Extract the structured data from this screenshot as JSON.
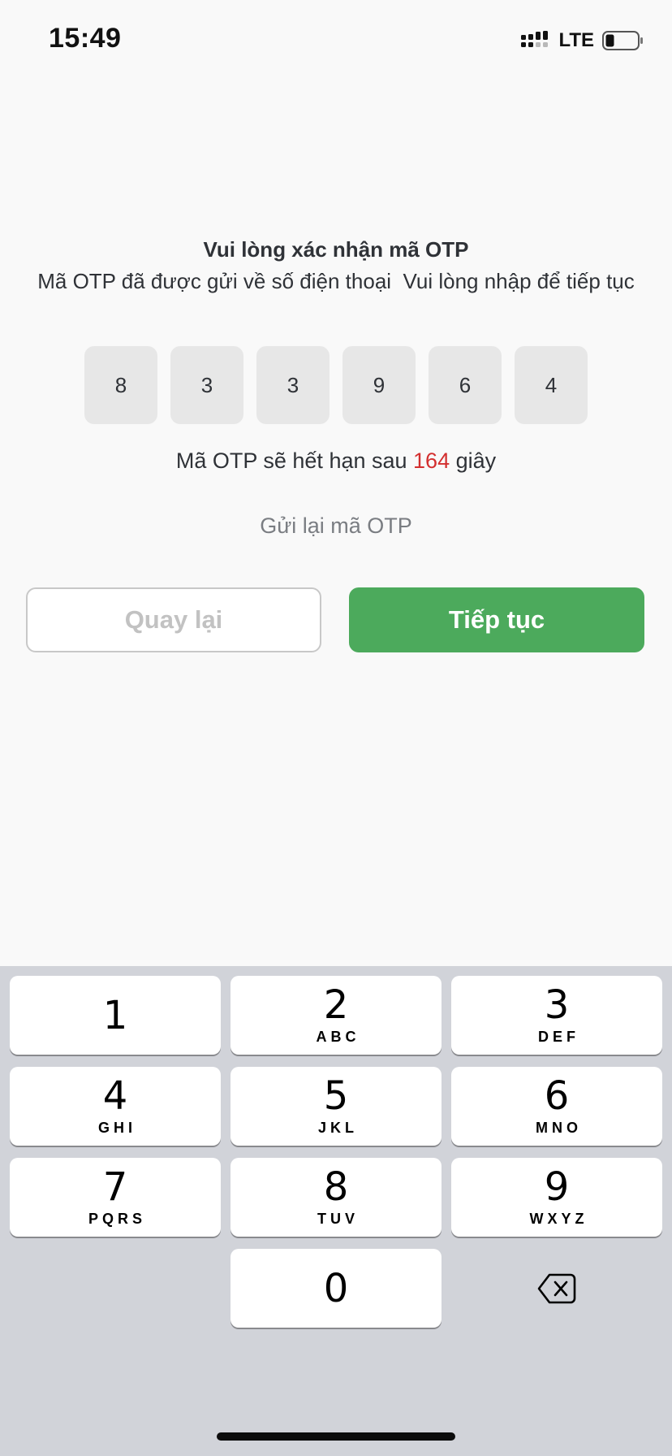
{
  "status_bar": {
    "time": "15:49",
    "network": "LTE",
    "icons": [
      "signal-icon",
      "battery-icon"
    ]
  },
  "otp": {
    "title": "Vui lòng xác nhận mã OTP",
    "subtitle": "Mã OTP đã được gửi về số điện thoại  Vui lòng nhập để tiếp tục",
    "digits": [
      "8",
      "3",
      "3",
      "9",
      "6",
      "4"
    ],
    "expiry_prefix": "Mã OTP sẽ hết hạn sau ",
    "expiry_seconds": "164",
    "expiry_suffix": " giây",
    "resend_label": "Gửi lại mã OTP"
  },
  "actions": {
    "back_label": "Quay lại",
    "continue_label": "Tiếp tục"
  },
  "keyboard": {
    "keys": [
      {
        "digit": "1",
        "letters": ""
      },
      {
        "digit": "2",
        "letters": "ABC"
      },
      {
        "digit": "3",
        "letters": "DEF"
      },
      {
        "digit": "4",
        "letters": "GHI"
      },
      {
        "digit": "5",
        "letters": "JKL"
      },
      {
        "digit": "6",
        "letters": "MNO"
      },
      {
        "digit": "7",
        "letters": "PQRS"
      },
      {
        "digit": "8",
        "letters": "TUV"
      },
      {
        "digit": "9",
        "letters": "WXYZ"
      },
      {
        "digit": "0",
        "letters": ""
      }
    ],
    "backspace_icon": "backspace-icon"
  },
  "colors": {
    "accent_green": "#4caa5c",
    "countdown_red": "#d32f2f",
    "keyboard_bg": "#d1d3d9"
  }
}
